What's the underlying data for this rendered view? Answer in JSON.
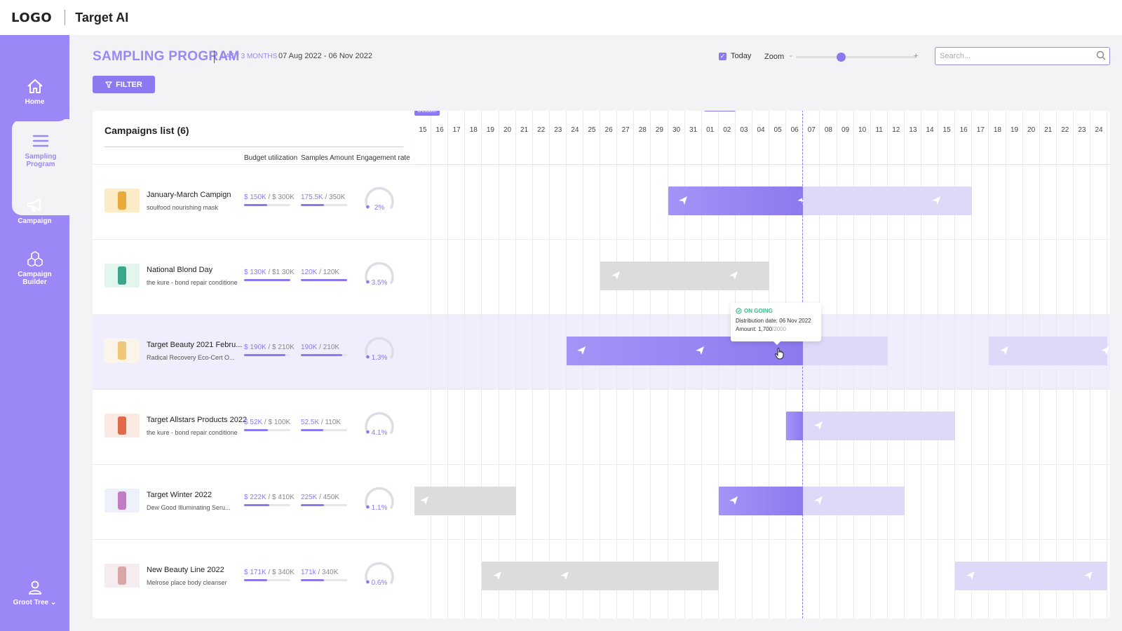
{
  "header": {
    "logo": "LOGO",
    "app_title": "Target AI"
  },
  "sidebar": {
    "items": [
      {
        "label": "Home",
        "icon": "home-icon"
      },
      {
        "label": "Sampling Program",
        "icon": "list-icon",
        "active": true
      },
      {
        "label": "Campaign",
        "icon": "megaphone-icon"
      },
      {
        "label": "Campaign Builder",
        "icon": "cubes-icon"
      }
    ],
    "user": {
      "label": "Groot Tree",
      "icon": "user-icon"
    }
  },
  "page": {
    "title": "SAMPLING PROGRAM",
    "range_label": "LAST 3 MONTHS",
    "range_dates": "07 Aug 2022 - 06 Nov 2022",
    "filter_label": "FILTER"
  },
  "controls": {
    "today_label": "Today",
    "today_checked": true,
    "zoom_label": "Zoom",
    "zoom_minus": "-",
    "zoom_plus": "+",
    "zoom_level": 0.37,
    "search_placeholder": "Search..."
  },
  "list": {
    "title": "Campaigns list (6)",
    "columns": [
      "Budget utilization",
      "Samples Amount",
      "Engagement rate"
    ],
    "campaigns": [
      {
        "name": "January-March Campign",
        "product": "soulfood nourishing mask",
        "budget_used": "$ 150K",
        "budget_total": " / $ 300K",
        "budget_fill": 0.5,
        "samples_used": "175.5K",
        "samples_total": " / 350K",
        "samples_fill": 0.5,
        "engagement": "2%",
        "engagement_value": 0.02
      },
      {
        "name": "National Blond Day",
        "product": "the kure - bond repair conditione",
        "budget_used": "$ 130K",
        "budget_total": " / $1 30K",
        "budget_fill": 1.0,
        "samples_used": "120K",
        "samples_total": " / 120K",
        "samples_fill": 1.0,
        "engagement": "3.5%",
        "engagement_value": 0.035
      },
      {
        "name": "Target Beauty 2021 Febru...",
        "product": "Radical Recovery Eco-Cert O...",
        "budget_used": "$ 190K",
        "budget_total": " / $ 210K",
        "budget_fill": 0.9,
        "samples_used": "190K",
        "samples_total": " / 210K",
        "samples_fill": 0.9,
        "engagement": "1.3%",
        "engagement_value": 0.013
      },
      {
        "name": "Target Allstars Products 2022",
        "product": "the kure - bond repair conditione",
        "budget_used": "$ 52K",
        "budget_total": " / $ 100K",
        "budget_fill": 0.52,
        "samples_used": "52.5K",
        "samples_total": " / 110K",
        "samples_fill": 0.48,
        "engagement": "4.1%",
        "engagement_value": 0.041
      },
      {
        "name": "Target Winter 2022",
        "product": "Dew Good Illuminating Seru...",
        "budget_used": "$ 222K",
        "budget_total": " / $ 410K",
        "budget_fill": 0.54,
        "samples_used": "225K",
        "samples_total": " / 450K",
        "samples_fill": 0.5,
        "engagement": "1.1%",
        "engagement_value": 0.011
      },
      {
        "name": "New Beauty Line 2022",
        "product": "Melrose place body cleanser",
        "budget_used": "$ 171K",
        "budget_total": " / $ 340K",
        "budget_fill": 0.5,
        "samples_used": "171k",
        "samples_total": " / 340K",
        "samples_fill": 0.5,
        "engagement": "0.6%",
        "engagement_value": 0.006
      }
    ]
  },
  "timeline": {
    "months": [
      {
        "label": "October",
        "start_day_index": 0
      },
      {
        "label": "November",
        "start_day_index": 17
      }
    ],
    "days": [
      "15",
      "16",
      "17",
      "18",
      "19",
      "20",
      "21",
      "22",
      "23",
      "24",
      "25",
      "26",
      "27",
      "28",
      "29",
      "30",
      "31",
      "01",
      "02",
      "03",
      "04",
      "05",
      "06",
      "07",
      "08",
      "09",
      "10",
      "11",
      "12",
      "13",
      "14",
      "15",
      "16",
      "17",
      "18",
      "19",
      "20",
      "21",
      "22",
      "23",
      "24"
    ],
    "today_day_index": 23,
    "bars": [
      [
        {
          "start": 15,
          "end": 23,
          "style": "filled",
          "planes": [
            15.6,
            22.6
          ]
        },
        {
          "start": 23,
          "end": 33,
          "style": "light",
          "planes": [
            30.6
          ]
        }
      ],
      [
        {
          "start": 11,
          "end": 21,
          "style": "grey",
          "planes": [
            11.6,
            18.6
          ]
        }
      ],
      [
        {
          "start": 9,
          "end": 23,
          "style": "filled",
          "planes": [
            9.6,
            16.6
          ]
        },
        {
          "start": 23,
          "end": 28,
          "style": "light",
          "planes": []
        },
        {
          "start": 34,
          "end": 41,
          "style": "light",
          "planes": [
            34.6,
            40.6
          ]
        }
      ],
      [
        {
          "start": 22,
          "end": 23,
          "style": "filled",
          "planes": []
        },
        {
          "start": 23,
          "end": 32,
          "style": "light",
          "planes": [
            23.6
          ]
        }
      ],
      [
        {
          "start": 0,
          "end": 6,
          "style": "grey",
          "planes": [
            0.3
          ]
        },
        {
          "start": 18,
          "end": 23,
          "style": "filled",
          "planes": [
            18.6
          ]
        },
        {
          "start": 23,
          "end": 29,
          "style": "light",
          "planes": [
            23.6
          ]
        }
      ],
      [
        {
          "start": 4,
          "end": 18,
          "style": "grey",
          "planes": [
            4.6,
            8.6
          ]
        },
        {
          "start": 32,
          "end": 41,
          "style": "light",
          "planes": [
            32.6,
            39.6
          ]
        }
      ]
    ],
    "tooltip": {
      "status": "ON GOING",
      "distribution": "Distribution date: 06 Nov 2022",
      "amount_label": "Amount: 1,700",
      "amount_total": "/2000"
    }
  },
  "colors": {
    "accent": "#8c79ef",
    "sidebar": "#9b87f5",
    "ongoing": "#3cb78f",
    "grey_bar": "#dcdcdc",
    "light_bar": "#dddaf9"
  }
}
